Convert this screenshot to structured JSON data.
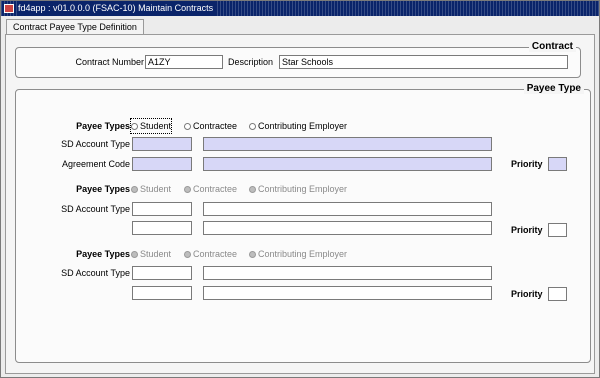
{
  "window": {
    "title": "fd4app : v01.0.0.0 (FSAC-10) Maintain Contracts"
  },
  "tab": {
    "label": "Contract Payee Type Definition"
  },
  "contract": {
    "group_title": "Contract",
    "number_label": "Contract Number",
    "number_value": "A1ZY",
    "description_label": "Description",
    "description_value": "Star Schools"
  },
  "payee": {
    "group_title": "Payee Type",
    "sections": [
      {
        "types_label": "Payee Types",
        "options": [
          "Student",
          "Contractee",
          "Contributing Employer"
        ],
        "sd_label": "SD Account Type",
        "sd_code": "",
        "sd_desc": "",
        "row2_label": "Agreement Code",
        "row2_code": "",
        "row2_desc": "",
        "priority_label": "Priority",
        "priority_value": ""
      },
      {
        "types_label": "Payee Types",
        "options": [
          "Student",
          "Contractee",
          "Contributing Employer"
        ],
        "sd_label": "SD Account Type",
        "sd_code": "",
        "sd_desc": "",
        "row2_code": "",
        "row2_desc": "",
        "priority_label": "Priority",
        "priority_value": ""
      },
      {
        "types_label": "Payee Types",
        "options": [
          "Student",
          "Contractee",
          "Contributing Employer"
        ],
        "sd_label": "SD Account Type",
        "sd_code": "",
        "sd_desc": "",
        "row2_code": "",
        "row2_desc": "",
        "priority_label": "Priority",
        "priority_value": ""
      }
    ]
  }
}
